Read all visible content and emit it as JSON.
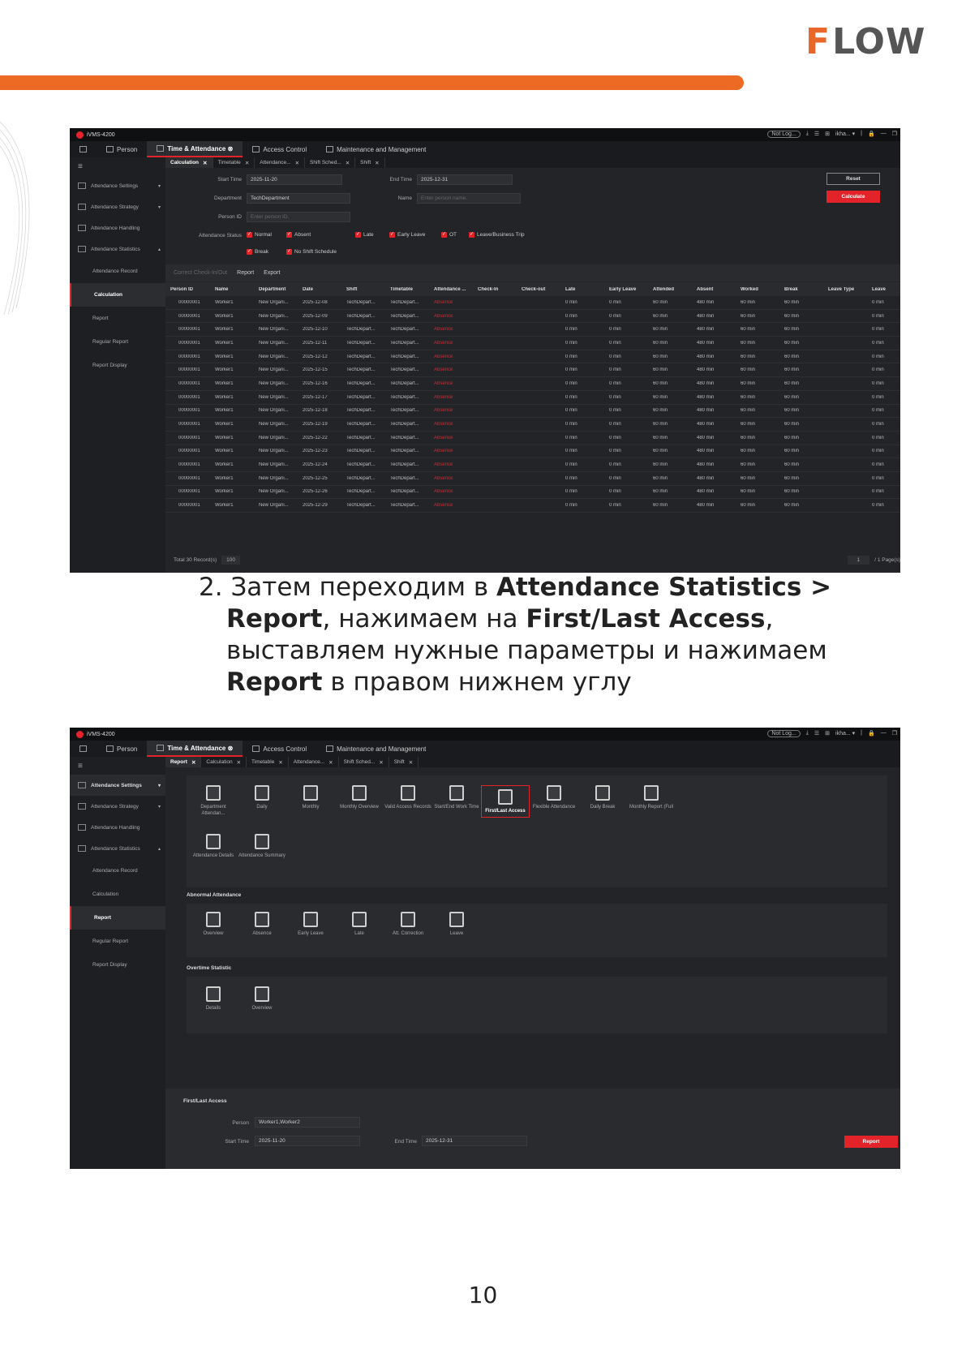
{
  "brand": {
    "logo_f": "F",
    "logo_rest": "LOW",
    "orange": "#ec6a23"
  },
  "app1": {
    "title": "iVMS-4200",
    "tr": [
      "Not Log...",
      "⤓",
      "☰",
      "⊞",
      "ikha... ▾",
      "|",
      "🔒",
      "—",
      "❐"
    ],
    "nav": [
      "Person",
      "Time & Attendance ⊗",
      "Access Control",
      "Maintenance and Management"
    ],
    "side": [
      "Attendance Settings",
      "Attendance Strategy",
      "Attendance Handling",
      "Attendance Statistics",
      "Attendance Record",
      "Calculation",
      "Report",
      "Regular Report",
      "Report Display"
    ],
    "tabs": [
      "Calculation",
      "Timetable",
      "Attendance...",
      "Shift Sched...",
      "Shift"
    ],
    "labels": {
      "start": "Start Time",
      "end": "End Time",
      "dept": "Department",
      "name": "Name",
      "pid": "Person ID",
      "status": "Attendance Status"
    },
    "values": {
      "start": "2025-11-20",
      "end": "2025-12-31",
      "dept": "TechDepartment",
      "name_ph": "Enter person name.",
      "pid_ph": "Enter person ID."
    },
    "buttons": {
      "reset": "Reset",
      "calc": "Calculate"
    },
    "checks": [
      "Normal",
      "Absent",
      "Late",
      "Early Leave",
      "OT",
      "Leave/Business Trip",
      "Break",
      "No Shift Schedule"
    ],
    "toolbar": [
      "Correct Check-In/Out",
      "Report",
      "Export"
    ],
    "columns": [
      "Person ID",
      "Name",
      "Department",
      "Date",
      "Shift",
      "Timetable",
      "Attendance ...",
      "Check-In",
      "Check-out",
      "Late",
      "Early Leave",
      "Attended",
      "Absent",
      "Worked",
      "Break",
      "Leave Type",
      "Leave"
    ],
    "rows": [
      [
        "00000001",
        "Worker1",
        "New Organi...",
        "2025-12-08",
        "TechDepart...",
        "TechDepart...",
        "Absence",
        "",
        "",
        "0 min",
        "0 min",
        "60 min",
        "480 min",
        "60 min",
        "60 min",
        "",
        "0 min"
      ],
      [
        "00000001",
        "Worker1",
        "New Organi...",
        "2025-12-09",
        "TechDepart...",
        "TechDepart...",
        "Absence",
        "",
        "",
        "0 min",
        "0 min",
        "60 min",
        "480 min",
        "60 min",
        "60 min",
        "",
        "0 min"
      ],
      [
        "00000001",
        "Worker1",
        "New Organi...",
        "2025-12-10",
        "TechDepart...",
        "TechDepart...",
        "Absence",
        "",
        "",
        "0 min",
        "0 min",
        "60 min",
        "480 min",
        "60 min",
        "60 min",
        "",
        "0 min"
      ],
      [
        "00000001",
        "Worker1",
        "New Organi...",
        "2025-12-11",
        "TechDepart...",
        "TechDepart...",
        "Absence",
        "",
        "",
        "0 min",
        "0 min",
        "60 min",
        "480 min",
        "60 min",
        "60 min",
        "",
        "0 min"
      ],
      [
        "00000001",
        "Worker1",
        "New Organi...",
        "2025-12-12",
        "TechDepart...",
        "TechDepart...",
        "Absence",
        "",
        "",
        "0 min",
        "0 min",
        "60 min",
        "480 min",
        "60 min",
        "60 min",
        "",
        "0 min"
      ],
      [
        "00000001",
        "Worker1",
        "New Organi...",
        "2025-12-15",
        "TechDepart...",
        "TechDepart...",
        "Absence",
        "",
        "",
        "0 min",
        "0 min",
        "60 min",
        "480 min",
        "60 min",
        "60 min",
        "",
        "0 min"
      ],
      [
        "00000001",
        "Worker1",
        "New Organi...",
        "2025-12-16",
        "TechDepart...",
        "TechDepart...",
        "Absence",
        "",
        "",
        "0 min",
        "0 min",
        "60 min",
        "480 min",
        "60 min",
        "60 min",
        "",
        "0 min"
      ],
      [
        "00000001",
        "Worker1",
        "New Organi...",
        "2025-12-17",
        "TechDepart...",
        "TechDepart...",
        "Absence",
        "",
        "",
        "0 min",
        "0 min",
        "60 min",
        "480 min",
        "60 min",
        "60 min",
        "",
        "0 min"
      ],
      [
        "00000001",
        "Worker1",
        "New Organi...",
        "2025-12-18",
        "TechDepart...",
        "TechDepart...",
        "Absence",
        "",
        "",
        "0 min",
        "0 min",
        "60 min",
        "480 min",
        "60 min",
        "60 min",
        "",
        "0 min"
      ],
      [
        "00000001",
        "Worker1",
        "New Organi...",
        "2025-12-19",
        "TechDepart...",
        "TechDepart...",
        "Absence",
        "",
        "",
        "0 min",
        "0 min",
        "60 min",
        "480 min",
        "60 min",
        "60 min",
        "",
        "0 min"
      ],
      [
        "00000001",
        "Worker1",
        "New Organi...",
        "2025-12-22",
        "TechDepart...",
        "TechDepart...",
        "Absence",
        "",
        "",
        "0 min",
        "0 min",
        "60 min",
        "480 min",
        "60 min",
        "60 min",
        "",
        "0 min"
      ],
      [
        "00000001",
        "Worker1",
        "New Organi...",
        "2025-12-23",
        "TechDepart...",
        "TechDepart...",
        "Absence",
        "",
        "",
        "0 min",
        "0 min",
        "60 min",
        "480 min",
        "60 min",
        "60 min",
        "",
        "0 min"
      ],
      [
        "00000001",
        "Worker1",
        "New Organi...",
        "2025-12-24",
        "TechDepart...",
        "TechDepart...",
        "Absence",
        "",
        "",
        "0 min",
        "0 min",
        "60 min",
        "480 min",
        "60 min",
        "60 min",
        "",
        "0 min"
      ],
      [
        "00000001",
        "Worker1",
        "New Organi...",
        "2025-12-25",
        "TechDepart...",
        "TechDepart...",
        "Absence",
        "",
        "",
        "0 min",
        "0 min",
        "60 min",
        "480 min",
        "60 min",
        "60 min",
        "",
        "0 min"
      ],
      [
        "00000001",
        "Worker1",
        "New Organi...",
        "2025-12-26",
        "TechDepart...",
        "TechDepart...",
        "Absence",
        "",
        "",
        "0 min",
        "0 min",
        "60 min",
        "480 min",
        "60 min",
        "60 min",
        "",
        "0 min"
      ],
      [
        "00000001",
        "Worker1",
        "New Organi...",
        "2025-12-29",
        "TechDepart...",
        "TechDepart...",
        "Absence",
        "",
        "",
        "0 min",
        "0 min",
        "60 min",
        "480 min",
        "60 min",
        "60 min",
        "",
        "0 min"
      ]
    ],
    "footer": {
      "total": "Total 30 Record(s)",
      "per_page": "100",
      "page": "1",
      "pages": "/ 1 Page(s)"
    }
  },
  "caption": {
    "num": "2.",
    "p1": "Затем переходим в ",
    "b1": "Attendance Statistics >",
    "b2": "Report",
    "p2": ", нажимаем на ",
    "b3": "First/Last Access",
    "p3": ",",
    "p4": "выставляем нужные параметры и нажимаем",
    "b4": "Report",
    "p5": " в правом нижнем углу"
  },
  "app2": {
    "tabs": [
      "Report",
      "Calculation",
      "Timetable",
      "Attendance...",
      "Shift Sched...",
      "Shift"
    ],
    "tiles1": [
      "Department Attendan...",
      "Daily",
      "Monthly",
      "Monthly Overview",
      "Valid Access Records",
      "Start/End Work Time",
      "First/Last Access",
      "Flexible Attendance",
      "Daily Break",
      "Monthly Report (Full"
    ],
    "tiles2": [
      "Attendance Details",
      "Attendance Summary"
    ],
    "sec_abn": "Abnormal Attendance",
    "abn": [
      "Overview",
      "Absence",
      "Early Leave",
      "Late",
      "Att. Correction",
      "Leave"
    ],
    "sec_ot": "Overtime Statistic",
    "ot": [
      "Details",
      "Overview"
    ],
    "form": {
      "title": "First/Last Access",
      "person_l": "Person",
      "person_v": "Worker1,Worker2",
      "start_l": "Start Time",
      "start_v": "2025-11-20",
      "end_l": "End Time",
      "end_v": "2025-12-31",
      "report": "Report"
    }
  },
  "page_number": "10"
}
